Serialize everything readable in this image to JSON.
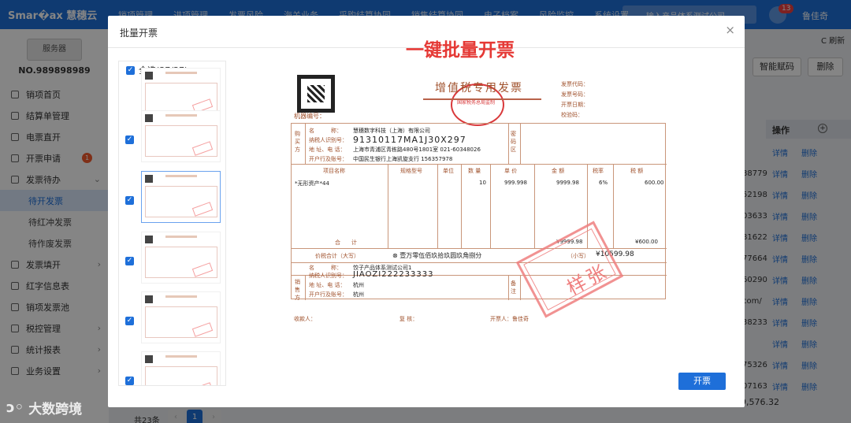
{
  "app": {
    "logo": "Smar�ax 慧穗云",
    "notifications": "13",
    "user": "鲁佳奇"
  },
  "topnav": [
    "销项管理",
    "进项管理",
    "发票风险",
    "海关业务",
    "采购结算协同",
    "销售结算协同",
    "电子档案",
    "风险监控",
    "系统设置"
  ],
  "search_placeholder": "输入产品体系测试公司",
  "sidebar": {
    "server_label": "服务器",
    "account": "NO.989898989",
    "items": [
      {
        "label": "销项首页"
      },
      {
        "label": "结算单管理"
      },
      {
        "label": "电票直开"
      },
      {
        "label": "开票申请",
        "badge": "1"
      },
      {
        "label": "发票待办",
        "arrow": "⌄"
      },
      {
        "label": "待开发票",
        "sub": true,
        "active": true
      },
      {
        "label": "待红冲发票",
        "sub": true
      },
      {
        "label": "待作废发票",
        "sub": true
      },
      {
        "label": "发票填开",
        "arrow": "›"
      },
      {
        "label": "红字信息表"
      },
      {
        "label": "销项发票池"
      },
      {
        "label": "税控管理",
        "arrow": "›"
      },
      {
        "label": "统计报表",
        "arrow": "›"
      },
      {
        "label": "业务设置",
        "arrow": "›"
      }
    ]
  },
  "toolbar": {
    "refresh": "C 刷新",
    "smart_code": "智能赋码",
    "delete": "删除"
  },
  "table": {
    "op_header": "操作",
    "rows": [
      {
        "num": "",
        "a": "详情",
        "b": "删除"
      },
      {
        "num": "88779",
        "a": "详情",
        "b": "删除"
      },
      {
        "num": "52198",
        "a": "详情",
        "b": "删除"
      },
      {
        "num": "03633",
        "a": "详情",
        "b": "删除"
      },
      {
        "num": "81622",
        "a": "详情",
        "b": "删除"
      },
      {
        "num": "77664",
        "a": "详情",
        "b": "删除"
      },
      {
        "num": "60290",
        "a": "详情",
        "b": "删除"
      },
      {
        "num": "com/",
        "a": "详情",
        "b": "删除"
      },
      {
        "num": "38233",
        "a": "详情",
        "b": "删除"
      },
      {
        "num": "",
        "a": "详情",
        "b": "删除"
      },
      {
        "num": "75326",
        "a": "详情",
        "b": "删除"
      },
      {
        "num": "07163",
        "a": "详情",
        "b": "删除"
      }
    ],
    "total_amount": "9,576.32"
  },
  "pagination": {
    "total": "共23条",
    "current": "1",
    "prev": "‹",
    "next": "›"
  },
  "watermark": "大数跨境",
  "modal": {
    "title": "批量开票",
    "close": "×",
    "banner": "一键批量开票",
    "select_all": "全选(37/37)",
    "submit": "开票"
  },
  "invoice": {
    "password_label": "机器编号：",
    "title": "增值税专用发票",
    "seal_text": "国家税务总局监制",
    "meta": [
      "发票代码：",
      "发票号码：",
      "开票日期：",
      "校验码："
    ],
    "buyer_side": "购买方",
    "buyer_name_label": "名　　　称：",
    "buyer_name": "慧穗数字科技（上海）有限公司",
    "buyer_tax_label": "纳税人识别号：",
    "buyer_tax": "91310117MA1J30X297",
    "buyer_addr_label": "地 址、电 话：",
    "buyer_addr": "上海市青浦区青栋路480号1801室 021-60348026",
    "buyer_bank_label": "开户行及账号：",
    "buyer_bank": "中国民生银行上海凯旋支行 156357978",
    "pwd_zone": "密码区",
    "cols": [
      "项目名称",
      "规格型号",
      "单位",
      "数 量",
      "单 价",
      "金 额",
      "税率",
      "税 额"
    ],
    "item_name": "*无形资产*44",
    "item_qty": "10",
    "item_price": "999.998",
    "item_amount": "9999.98",
    "item_rate": "6%",
    "item_tax": "600.00",
    "sum_label": "合　　计",
    "sum_amount": "¥9999.98",
    "sum_tax": "¥600.00",
    "total_words_label": "价税合计（大写）",
    "total_words": "壹万零伍佰玖拾玖圆玖角捌分",
    "total_small_label": "（小写）",
    "total_small": "¥10599.98",
    "seller_side": "销售方",
    "seller_name": "饺子产品体系测试公司1",
    "seller_tax": "JIAOZI222233333",
    "seller_addr": "杭州",
    "seller_bank": "杭州",
    "note_label": "备注",
    "payee": "收款人：",
    "reviewer": "复 核：",
    "drawer": "开票人：鲁佳奇",
    "stamp": "样张"
  },
  "colors": {
    "primary": "#1e6fd9",
    "invoice_line": "#c9967a",
    "stamp": "#ef7f7f",
    "banner": "#e53935"
  }
}
